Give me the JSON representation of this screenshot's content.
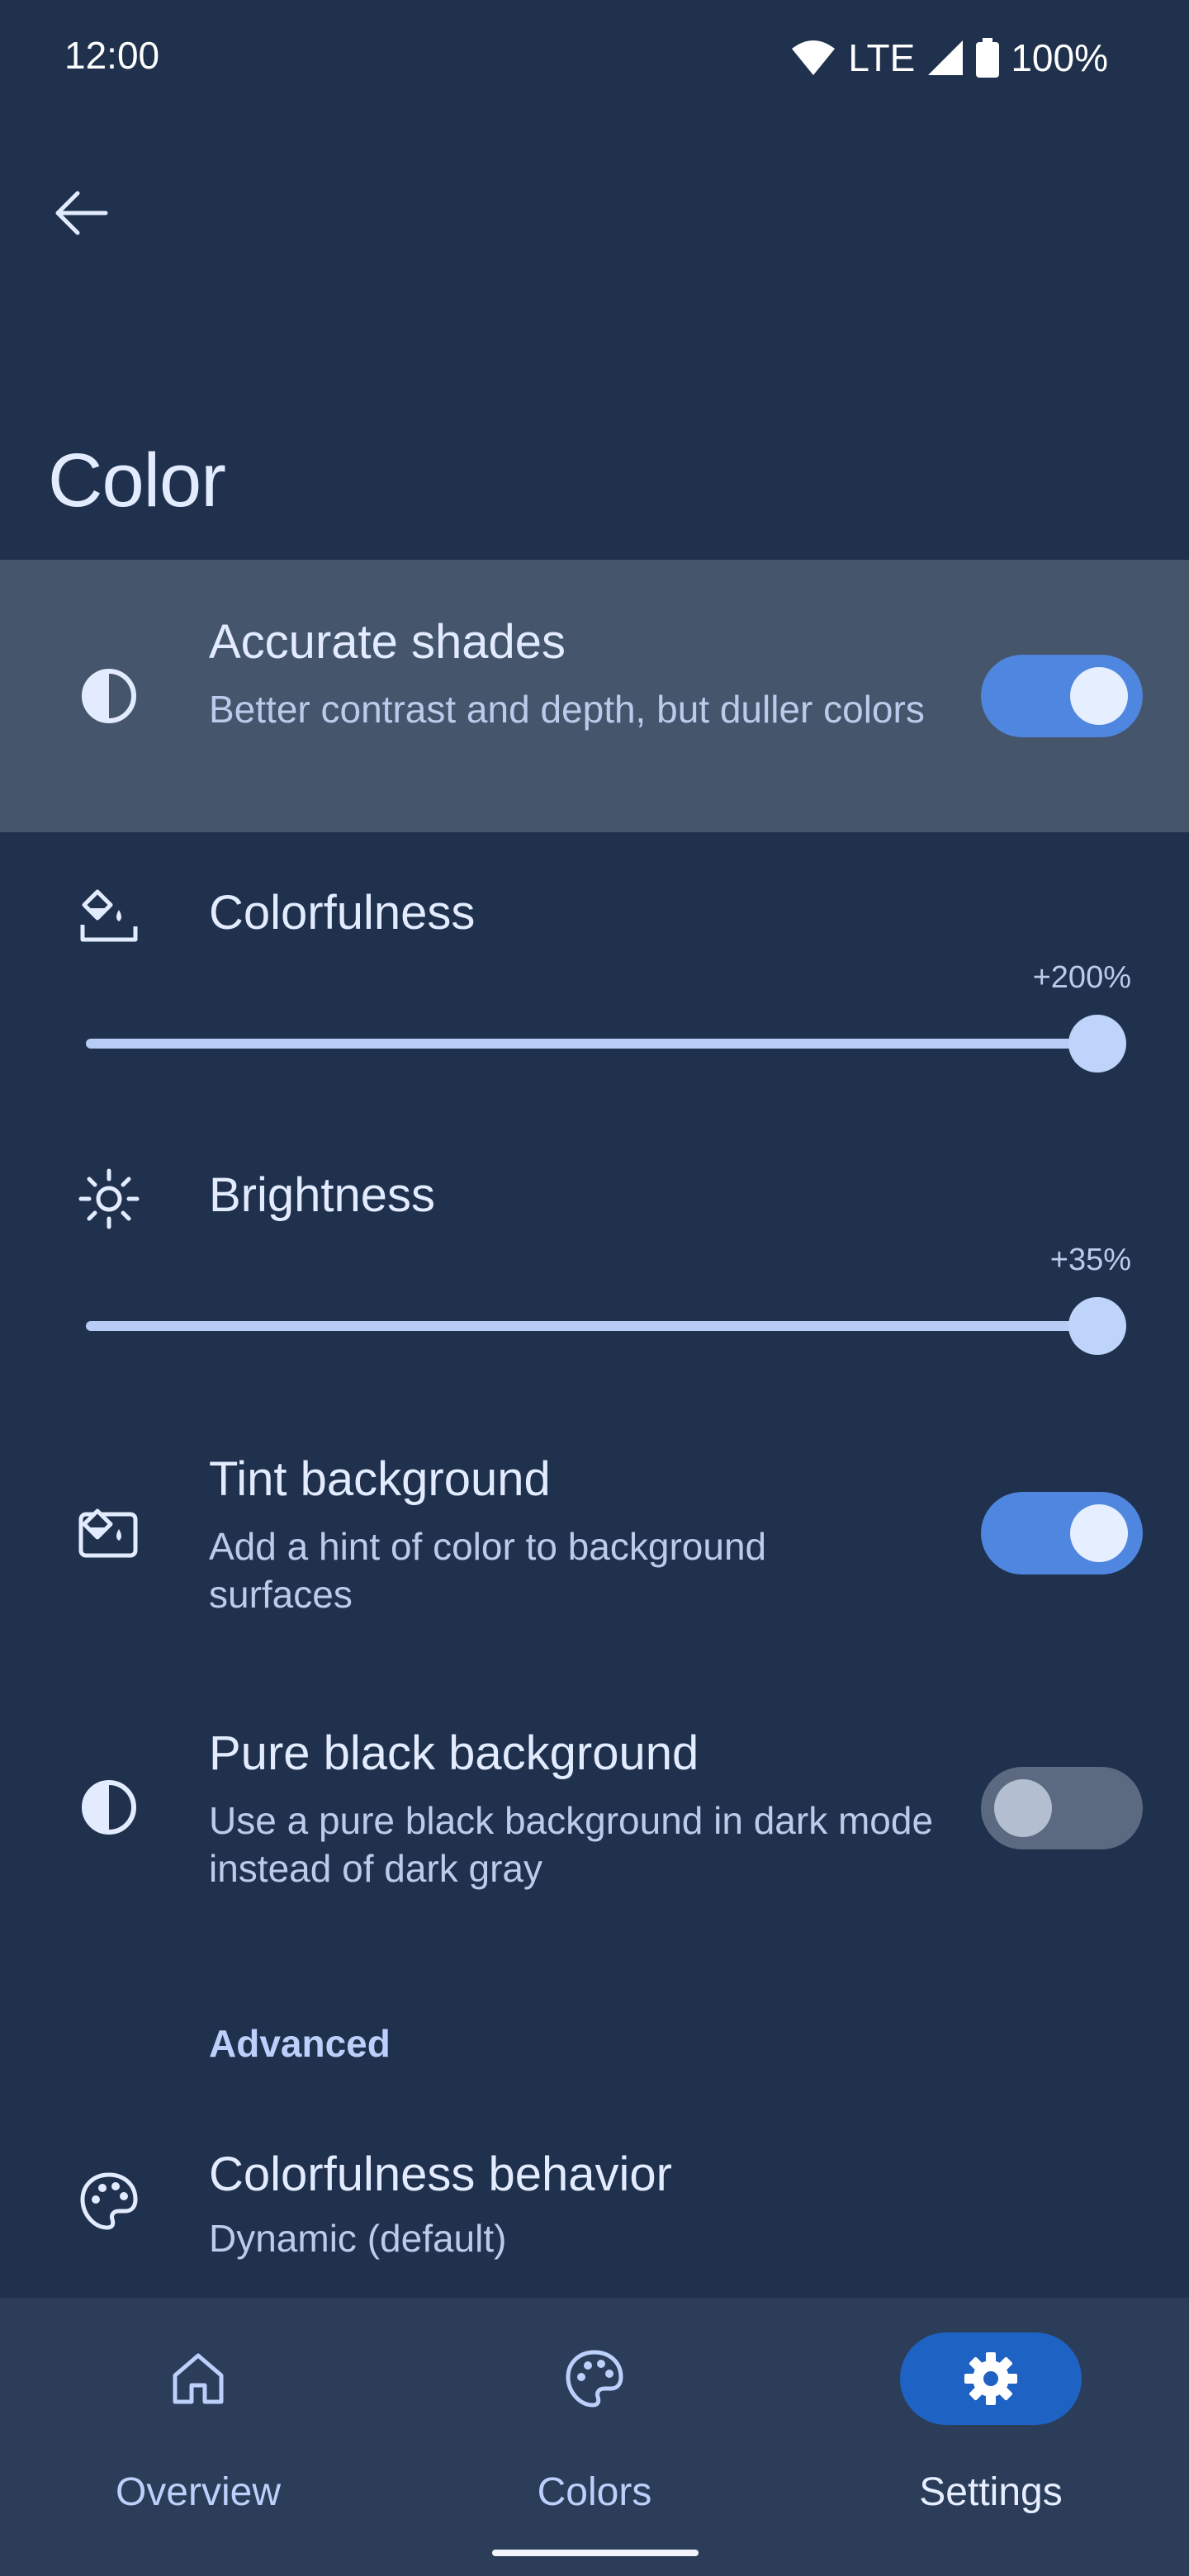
{
  "status_bar": {
    "time": "12:00",
    "network": "LTE",
    "battery": "100%"
  },
  "header": {
    "title": "Color"
  },
  "settings": {
    "accurate_shades": {
      "title": "Accurate shades",
      "desc": "Better contrast and depth, but duller colors",
      "enabled": true
    },
    "colorfulness": {
      "title": "Colorfulness",
      "value": "+200%",
      "level": 1.0
    },
    "brightness": {
      "title": "Brightness",
      "value": "+35%",
      "level": 1.0
    },
    "tint_background": {
      "title": "Tint background",
      "desc": "Add a hint of color to background surfaces",
      "enabled": true
    },
    "pure_black": {
      "title": "Pure black background",
      "desc": "Use a pure black background in dark mode instead of dark gray",
      "enabled": false
    },
    "advanced_header": "Advanced",
    "colorfulness_behavior": {
      "title": "Colorfulness behavior",
      "value": "Dynamic (default)"
    }
  },
  "bottom_nav": {
    "items": [
      {
        "label": "Overview",
        "icon": "home-icon"
      },
      {
        "label": "Colors",
        "icon": "palette-icon"
      },
      {
        "label": "Settings",
        "icon": "gear-icon",
        "active": true
      }
    ]
  },
  "colors": {
    "background": "#1f314c",
    "accent": "#4f86e0",
    "highlight": "#45566c"
  }
}
